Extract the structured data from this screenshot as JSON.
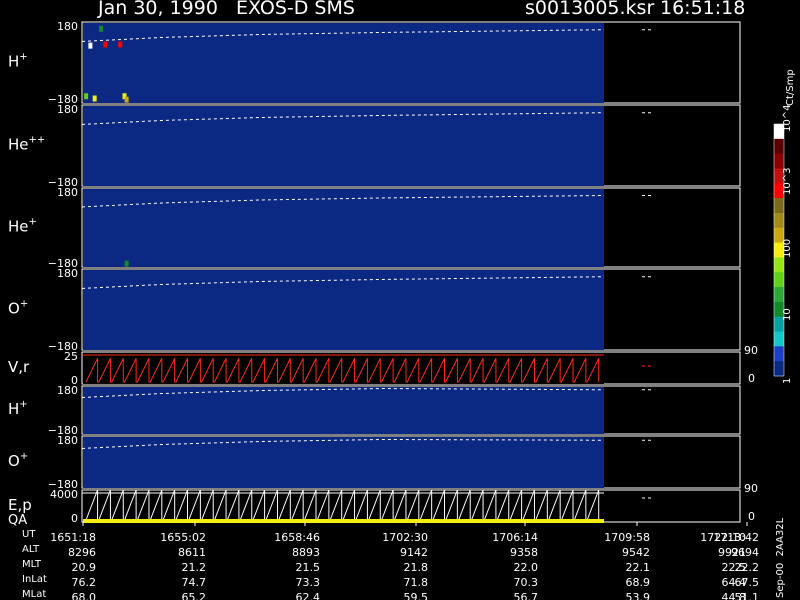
{
  "header": {
    "title": "Jan 30, 1990   EXOS-D SMS",
    "file": "s0013005.ksr",
    "time": "16:51:18"
  },
  "colors": {
    "background": "#0b2882",
    "panel_bg": "#000000",
    "trace": "#ffffff",
    "red_trace": "#ff2a1a",
    "qa_bar": "#f4ef10"
  },
  "colorbar": {
    "label": "Ct/Smp",
    "ticks": [
      "1",
      "10",
      "100",
      "10^3",
      "10^4"
    ],
    "colors": [
      "#0b2882",
      "#1c3fc5",
      "#14c8c8",
      "#0aa0a0",
      "#138a2a",
      "#2aa838",
      "#5ed21a",
      "#93e614",
      "#f4ef10",
      "#c9a812",
      "#a08c1a",
      "#7a6a1a",
      "#ff0000",
      "#c01010",
      "#8a0000",
      "#5a0000",
      "#ffffff"
    ]
  },
  "panels": [
    {
      "id": "H1",
      "label": "H",
      "sup": "+",
      "top_tick": "180",
      "bot_tick": "−180",
      "right_top": "",
      "right_bot": ""
    },
    {
      "id": "He2",
      "label": "He",
      "sup": "++",
      "top_tick": "180",
      "bot_tick": "−180",
      "right_top": "",
      "right_bot": ""
    },
    {
      "id": "He1",
      "label": "He",
      "sup": "+",
      "top_tick": "180",
      "bot_tick": "−180",
      "right_top": "",
      "right_bot": ""
    },
    {
      "id": "O1",
      "label": "O",
      "sup": "+",
      "top_tick": "180",
      "bot_tick": "−180",
      "right_top": "",
      "right_bot": ""
    },
    {
      "id": "Vr",
      "label": "V,r",
      "sup": "",
      "top_tick": "25",
      "bot_tick": "0",
      "right_top": "90",
      "right_bot": "0"
    },
    {
      "id": "H2",
      "label": "H",
      "sup": "+",
      "top_tick": "180",
      "bot_tick": "−180",
      "right_top": "",
      "right_bot": ""
    },
    {
      "id": "O2",
      "label": "O",
      "sup": "+",
      "top_tick": "180",
      "bot_tick": "−180",
      "right_top": "",
      "right_bot": ""
    },
    {
      "id": "Ep",
      "label": "E,p",
      "sup": "",
      "top_tick": "4000",
      "bot_tick": "0",
      "right_top": "90",
      "right_bot": "0",
      "extra_label": "QA"
    }
  ],
  "table": {
    "row_labels": [
      "UT",
      "ALT",
      "MLT",
      "InLat",
      "MLat"
    ],
    "columns": [
      {
        "UT": "1651:18",
        "ALT": "8296",
        "MLT": "20.9",
        "InLat": "76.2",
        "MLat": "68.0"
      },
      {
        "UT": "1655:02",
        "ALT": "8611",
        "MLT": "21.2",
        "InLat": "74.7",
        "MLat": "65.2"
      },
      {
        "UT": "1658:46",
        "ALT": "8893",
        "MLT": "21.5",
        "InLat": "73.3",
        "MLat": "62.4"
      },
      {
        "UT": "1702:30",
        "ALT": "9142",
        "MLT": "21.8",
        "InLat": "71.8",
        "MLat": "59.5"
      },
      {
        "UT": "1706:14",
        "ALT": "9358",
        "MLT": "22.0",
        "InLat": "70.3",
        "MLat": "56.7"
      },
      {
        "UT": "1709:58",
        "ALT": "9542",
        "MLT": "22.1",
        "InLat": "68.9",
        "MLat": "53.9"
      },
      {
        "UT": "1713:42",
        "ALT": "9694",
        "MLT": "22.2",
        "InLat": "67.5",
        "MLat": "51.1"
      },
      {
        "UT": "1722:10",
        "ALT": "9921",
        "MLT": "22.5",
        "InLat": "64.4",
        "MLat": "44.8"
      }
    ]
  },
  "footer": "Sep-00  2AA32L",
  "chart_data": {
    "type": "heatmap",
    "title": "Jan 30, 1990   EXOS-D SMS",
    "x_ticks": [
      "1651:18",
      "1655:02",
      "1658:46",
      "1702:30",
      "1706:14",
      "1709:58",
      "1713:42",
      "1722:10"
    ],
    "x_range": [
      "1651:18",
      "1722:10"
    ],
    "data_end": "1719:00",
    "series": [
      {
        "name": "H+",
        "ylim": [
          -180,
          180
        ],
        "trace": [
          20,
          31
        ],
        "hotspots": [
          {
            "t": 0.2,
            "y": 160,
            "level": 1
          },
          {
            "t": 0.8,
            "y": 150,
            "level": 10
          },
          {
            "t": 0.3,
            "y": 75,
            "level": 10000
          },
          {
            "t": 1.0,
            "y": 80,
            "level": 1000
          },
          {
            "t": 1.7,
            "y": 80,
            "level": 1000
          },
          {
            "t": 0.1,
            "y": -150,
            "level": 30
          },
          {
            "t": 0.5,
            "y": -160,
            "level": 100
          },
          {
            "t": 1.9,
            "y": -150,
            "level": 100
          },
          {
            "t": 2.0,
            "y": -165,
            "level": 200
          }
        ]
      },
      {
        "name": "He++",
        "ylim": [
          -180,
          180
        ],
        "trace": [
          20,
          31
        ],
        "hotspots": []
      },
      {
        "name": "He+",
        "ylim": [
          -180,
          180
        ],
        "trace": [
          20,
          31
        ],
        "hotspots": [
          {
            "t": 2.0,
            "y": -165,
            "level": 10
          }
        ]
      },
      {
        "name": "O+",
        "ylim": [
          -180,
          180
        ],
        "trace": [
          20,
          31
        ],
        "hotspots": []
      },
      {
        "name": "V,r",
        "ylim": [
          0,
          25
        ],
        "right_ylim": [
          0,
          90
        ],
        "sawtooth_cycles": 40,
        "sawtooth_min": 0,
        "sawtooth_max": 20
      },
      {
        "name": "H+",
        "ylim": [
          -180,
          180
        ],
        "trace": [
          20,
          31
        ],
        "hotspots": []
      },
      {
        "name": "O+",
        "ylim": [
          -180,
          180
        ],
        "trace": [
          20,
          31
        ],
        "hotspots": []
      },
      {
        "name": "E,p",
        "ylim": [
          0,
          4000
        ],
        "right_ylim": [
          0,
          90
        ],
        "sawtooth_cycles": 40,
        "sawtooth_min": 0,
        "sawtooth_max": 4000
      }
    ]
  }
}
